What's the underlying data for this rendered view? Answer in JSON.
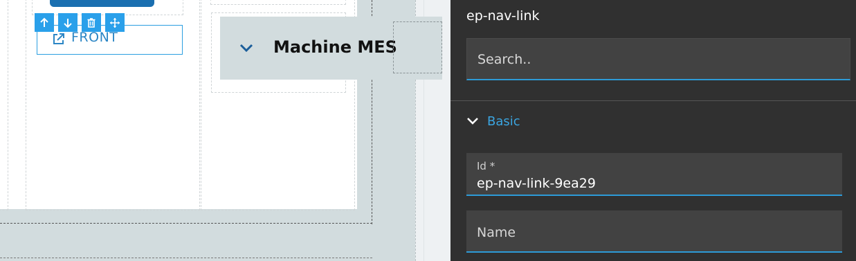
{
  "canvas": {
    "front_link_label": "FRONT",
    "machine_title": "Machine MES",
    "toolbar": {
      "move_up_icon": "arrow-up-icon",
      "move_down_icon": "arrow-down-icon",
      "delete_icon": "trash-icon",
      "drag_icon": "move-icon"
    }
  },
  "panel": {
    "component_name": "ep-nav-link",
    "search_placeholder": "Search..",
    "section_basic": "Basic",
    "fields": {
      "id_label": "Id *",
      "id_value": "ep-nav-link-9ea29",
      "name_label": "Name"
    }
  },
  "colors": {
    "accent": "#2d9bd8",
    "toolbar_blue": "#2aa0ea",
    "panel_bg": "#303030",
    "field_bg": "#424242",
    "canvas_grey": "#d2dcde"
  }
}
